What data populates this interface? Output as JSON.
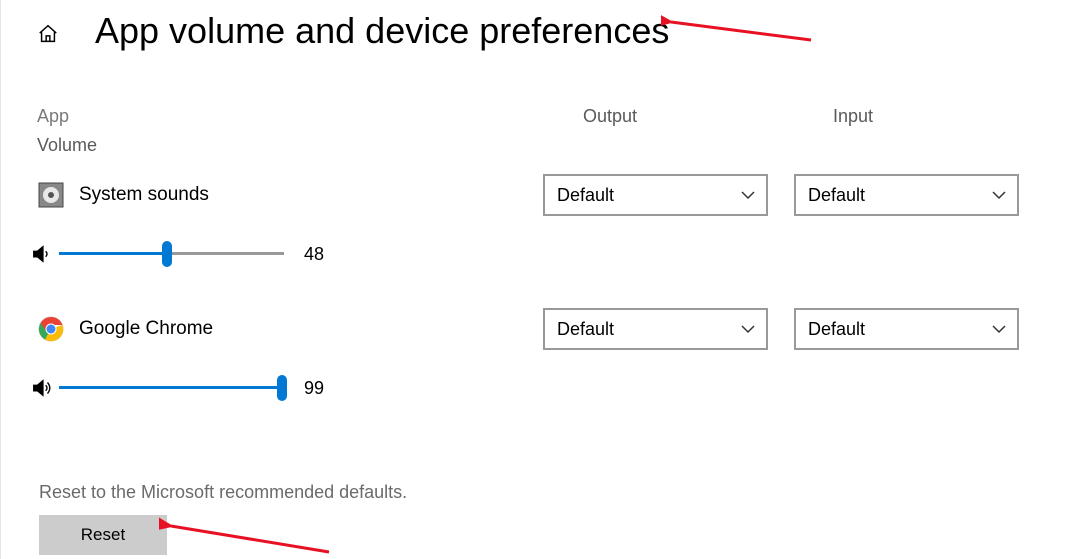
{
  "header": {
    "title": "App volume and device preferences"
  },
  "columns": {
    "app": "App",
    "volume": "Volume",
    "output": "Output",
    "input": "Input"
  },
  "apps": [
    {
      "name": "System sounds",
      "icon": "system-sounds",
      "volume": 48,
      "output": "Default",
      "input": "Default"
    },
    {
      "name": "Google Chrome",
      "icon": "chrome",
      "volume": 99,
      "output": "Default",
      "input": "Default"
    }
  ],
  "reset": {
    "text": "Reset to the Microsoft recommended defaults.",
    "button": "Reset"
  }
}
